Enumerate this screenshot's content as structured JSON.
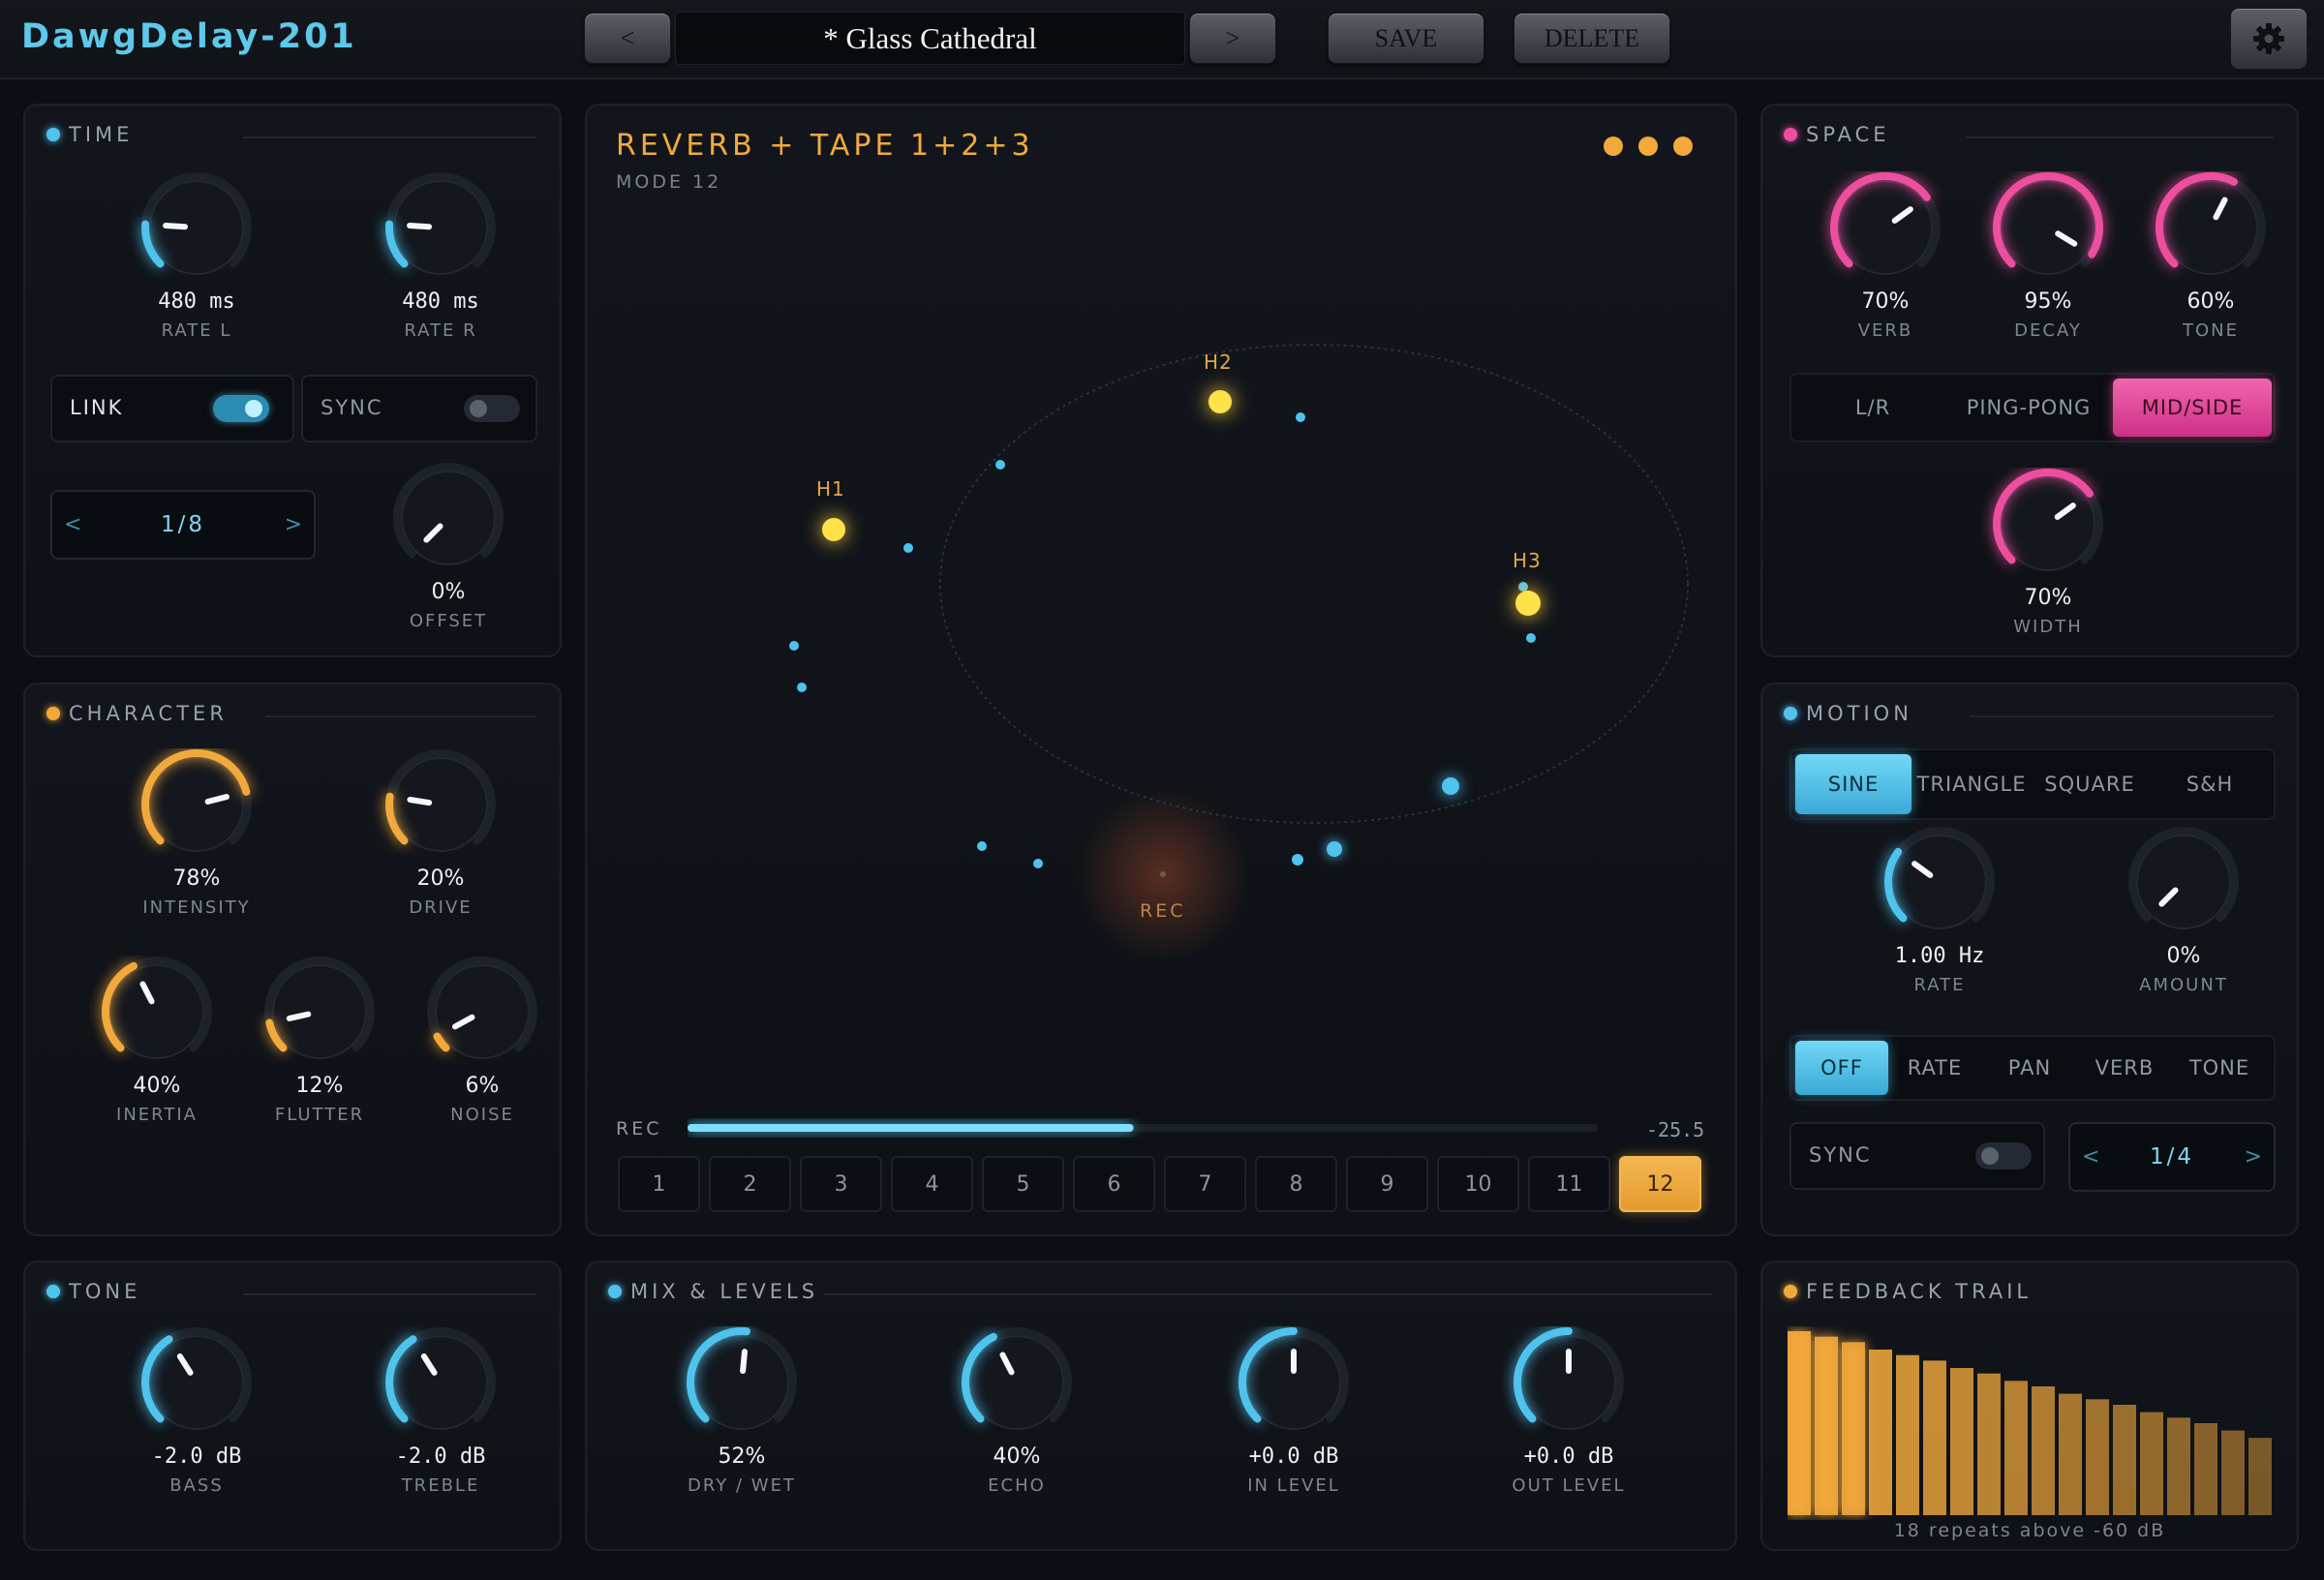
{
  "header": {
    "app_title": "DawgDelay-201",
    "prev_label": "<",
    "next_label": ">",
    "preset_name": "* Glass Cathedral",
    "save_label": "SAVE",
    "delete_label": "DELETE"
  },
  "time": {
    "title": "TIME",
    "rate_l": {
      "value": "480 ms",
      "label": "RATE L",
      "level": 0.18
    },
    "rate_r": {
      "value": "480 ms",
      "label": "RATE R",
      "level": 0.18
    },
    "link": {
      "label": "LINK",
      "on": true
    },
    "sync": {
      "label": "SYNC",
      "on": false
    },
    "division": {
      "value": "1/8",
      "left": "<",
      "right": ">"
    },
    "offset": {
      "value": "0%",
      "label": "OFFSET",
      "level": 0.0
    }
  },
  "character": {
    "title": "CHARACTER",
    "knobs": [
      {
        "value": "78%",
        "label": "INTENSITY",
        "level": 0.78
      },
      {
        "value": "20%",
        "label": "DRIVE",
        "level": 0.2
      },
      {
        "value": "40%",
        "label": "INERTIA",
        "level": 0.4
      },
      {
        "value": "12%",
        "label": "FLUTTER",
        "level": 0.12
      },
      {
        "value": "6%",
        "label": "NOISE",
        "level": 0.06
      }
    ]
  },
  "tone": {
    "title": "TONE",
    "knobs": [
      {
        "value": "-2.0 dB",
        "label": "BASS",
        "level": 0.38
      },
      {
        "value": "-2.0 dB",
        "label": "TREBLE",
        "level": 0.38
      }
    ]
  },
  "display": {
    "mode_title": "REVERB + TAPE 1+2+3",
    "mode_sub": "MODE 12",
    "heads": [
      "H1",
      "H2",
      "H3"
    ],
    "rec_center_label": "REC",
    "rec_label": "REC",
    "rec_level_db": "-25.5",
    "rec_level_fraction": 0.49,
    "slots": [
      "1",
      "2",
      "3",
      "4",
      "5",
      "6",
      "7",
      "8",
      "9",
      "10",
      "11",
      "12"
    ],
    "active_slot": "12"
  },
  "mix": {
    "title": "MIX & LEVELS",
    "knobs": [
      {
        "value": "52%",
        "label": "DRY / WET",
        "level": 0.52
      },
      {
        "value": "40%",
        "label": "ECHO",
        "level": 0.4
      },
      {
        "value": "+0.0 dB",
        "label": "IN LEVEL",
        "level": 0.5
      },
      {
        "value": "+0.0 dB",
        "label": "OUT LEVEL",
        "level": 0.5
      }
    ]
  },
  "space": {
    "title": "SPACE",
    "knobs": [
      {
        "value": "70%",
        "label": "VERB",
        "level": 0.7
      },
      {
        "value": "95%",
        "label": "DECAY",
        "level": 0.95
      },
      {
        "value": "60%",
        "label": "TONE",
        "level": 0.6
      }
    ],
    "modes": [
      "L/R",
      "PING-PONG",
      "MID/SIDE"
    ],
    "active_mode": "MID/SIDE",
    "width": {
      "value": "70%",
      "label": "WIDTH",
      "level": 0.7
    }
  },
  "motion": {
    "title": "MOTION",
    "waves": [
      "SINE",
      "TRIANGLE",
      "SQUARE",
      "S&H"
    ],
    "active_wave": "SINE",
    "rate": {
      "value": "1.00 Hz",
      "label": "RATE",
      "level": 0.3
    },
    "amount": {
      "value": "0%",
      "label": "AMOUNT",
      "level": 0.0
    },
    "targets": [
      "OFF",
      "RATE",
      "PAN",
      "VERB",
      "TONE"
    ],
    "active_target": "OFF",
    "sync": {
      "label": "SYNC",
      "on": false
    },
    "division": {
      "value": "1/4",
      "left": "<",
      "right": ">"
    }
  },
  "trail": {
    "title": "FEEDBACK TRAIL",
    "caption": "18 repeats above -60 dB",
    "repeat_levels": [
      1.0,
      0.97,
      0.94,
      0.9,
      0.87,
      0.84,
      0.8,
      0.77,
      0.73,
      0.7,
      0.66,
      0.63,
      0.6,
      0.56,
      0.53,
      0.5,
      0.46,
      0.42
    ]
  },
  "colors": {
    "cyan": "#4fc3ee",
    "orange": "#f2a93c",
    "pink": "#ee4ea0",
    "yellow": "#ffe24a"
  }
}
